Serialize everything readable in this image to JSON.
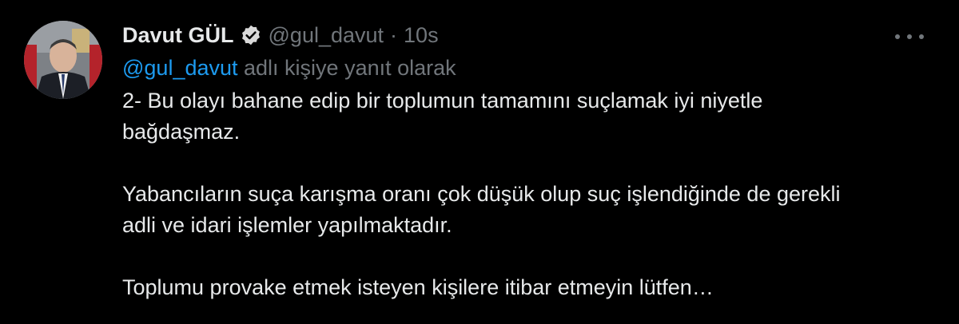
{
  "tweet": {
    "author": {
      "display_name": "Davut GÜL",
      "handle": "@gul_davut",
      "verified": true
    },
    "separator": "·",
    "time": "10s",
    "reply_to": {
      "mention": "@gul_davut",
      "suffix": " adlı kişiye yanıt olarak"
    },
    "paragraphs": [
      [
        "2- Bu olayı bahane edip bir toplumun tamamını suçlamak iyi niyetle",
        "bağdaşmaz."
      ],
      [
        "Yabancıların suça karışma oranı çok düşük olup suç işlendiğinde de gerekli",
        "adli ve idari işlemler yapılmaktadır."
      ],
      [
        "Toplumu provake etmek isteyen kişilere itibar etmeyin lütfen…"
      ]
    ]
  },
  "icons": {
    "verified": "verified-badge-icon",
    "more": "more-options-icon"
  },
  "colors": {
    "background": "#000000",
    "text": "#e7e9ea",
    "muted": "#71767b",
    "accent": "#1d9bf0"
  }
}
